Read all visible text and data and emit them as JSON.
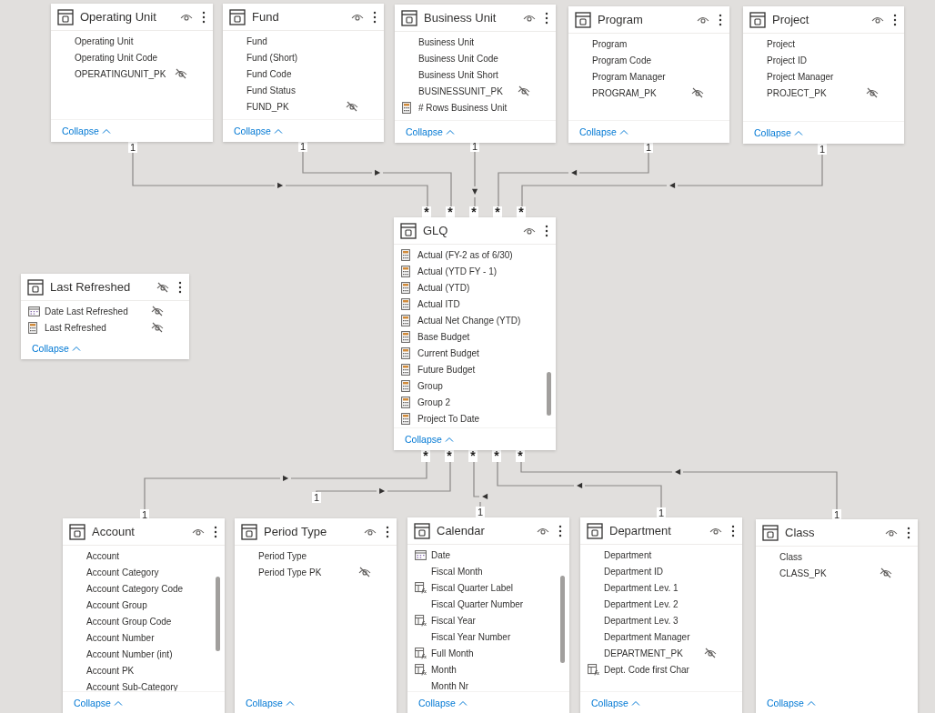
{
  "tables": [
    {
      "name": "Operating Unit",
      "hidden": false,
      "footer": "Collapse",
      "fields": [
        {
          "name": "Operating Unit",
          "kind": "column",
          "hidden": false
        },
        {
          "name": "Operating Unit Code",
          "kind": "column",
          "hidden": false
        },
        {
          "name": "OPERATINGUNIT_PK",
          "kind": "column",
          "hidden": true
        }
      ]
    },
    {
      "name": "Fund",
      "hidden": false,
      "footer": "Collapse",
      "fields": [
        {
          "name": "Fund",
          "kind": "column",
          "hidden": false
        },
        {
          "name": "Fund (Short)",
          "kind": "column",
          "hidden": false
        },
        {
          "name": "Fund Code",
          "kind": "column",
          "hidden": false
        },
        {
          "name": "Fund Status",
          "kind": "column",
          "hidden": false
        },
        {
          "name": "FUND_PK",
          "kind": "column",
          "hidden": true
        }
      ]
    },
    {
      "name": "Business Unit",
      "hidden": false,
      "footer": "Collapse",
      "fields": [
        {
          "name": "Business Unit",
          "kind": "column",
          "hidden": false
        },
        {
          "name": "Business Unit Code",
          "kind": "column",
          "hidden": false
        },
        {
          "name": "Business Unit Short",
          "kind": "column",
          "hidden": false
        },
        {
          "name": "BUSINESSUNIT_PK",
          "kind": "column",
          "hidden": true
        },
        {
          "name": "# Rows Business Unit",
          "kind": "measure",
          "hidden": false
        }
      ]
    },
    {
      "name": "Program",
      "hidden": false,
      "footer": "Collapse",
      "fields": [
        {
          "name": "Program",
          "kind": "column",
          "hidden": false
        },
        {
          "name": "Program Code",
          "kind": "column",
          "hidden": false
        },
        {
          "name": "Program Manager",
          "kind": "column",
          "hidden": false
        },
        {
          "name": "PROGRAM_PK",
          "kind": "column",
          "hidden": true
        }
      ]
    },
    {
      "name": "Project",
      "hidden": false,
      "footer": "Collapse",
      "fields": [
        {
          "name": "Project",
          "kind": "column",
          "hidden": false
        },
        {
          "name": "Project ID",
          "kind": "column",
          "hidden": false
        },
        {
          "name": "Project Manager",
          "kind": "column",
          "hidden": false
        },
        {
          "name": "PROJECT_PK",
          "kind": "column",
          "hidden": true
        }
      ]
    },
    {
      "name": "GLQ",
      "hidden": false,
      "footer": "Collapse",
      "fields": [
        {
          "name": "Actual (FY-2 as of 6/30)",
          "kind": "measure",
          "hidden": false
        },
        {
          "name": "Actual (YTD FY - 1)",
          "kind": "measure",
          "hidden": false
        },
        {
          "name": "Actual (YTD)",
          "kind": "measure",
          "hidden": false
        },
        {
          "name": "Actual ITD",
          "kind": "measure",
          "hidden": false
        },
        {
          "name": "Actual Net Change (YTD)",
          "kind": "measure",
          "hidden": false
        },
        {
          "name": "Base Budget",
          "kind": "measure",
          "hidden": false
        },
        {
          "name": "Current Budget",
          "kind": "measure",
          "hidden": false
        },
        {
          "name": "Future Budget",
          "kind": "measure",
          "hidden": false
        },
        {
          "name": "Group",
          "kind": "measure",
          "hidden": false
        },
        {
          "name": "Group 2",
          "kind": "measure",
          "hidden": false
        },
        {
          "name": "Project To Date",
          "kind": "measure",
          "hidden": false
        }
      ]
    },
    {
      "name": "Last Refreshed",
      "hidden": true,
      "footer": "Collapse",
      "fields": [
        {
          "name": "Date Last Refreshed",
          "kind": "date",
          "hidden": true
        },
        {
          "name": "Last Refreshed",
          "kind": "measure",
          "hidden": true
        }
      ]
    },
    {
      "name": "Account",
      "hidden": false,
      "footer": "Collapse",
      "fields": [
        {
          "name": "Account",
          "kind": "column",
          "hidden": false
        },
        {
          "name": "Account Category",
          "kind": "column",
          "hidden": false
        },
        {
          "name": "Account Category Code",
          "kind": "column",
          "hidden": false
        },
        {
          "name": "Account Group",
          "kind": "column",
          "hidden": false
        },
        {
          "name": "Account Group Code",
          "kind": "column",
          "hidden": false
        },
        {
          "name": "Account Number",
          "kind": "column",
          "hidden": false
        },
        {
          "name": "Account Number (int)",
          "kind": "column",
          "hidden": false
        },
        {
          "name": "Account PK",
          "kind": "column",
          "hidden": false
        },
        {
          "name": "Account Sub-Category",
          "kind": "column",
          "hidden": false
        }
      ]
    },
    {
      "name": "Period Type",
      "hidden": false,
      "footer": "Collapse",
      "fields": [
        {
          "name": "Period Type",
          "kind": "column",
          "hidden": false
        },
        {
          "name": "Period Type PK",
          "kind": "column",
          "hidden": true
        }
      ]
    },
    {
      "name": "Calendar",
      "hidden": false,
      "footer": "Collapse",
      "fields": [
        {
          "name": "Date",
          "kind": "date",
          "hidden": false
        },
        {
          "name": "Fiscal Month",
          "kind": "column",
          "hidden": false
        },
        {
          "name": "Fiscal Quarter Label",
          "kind": "calculated",
          "hidden": false
        },
        {
          "name": "Fiscal Quarter Number",
          "kind": "column",
          "hidden": false
        },
        {
          "name": "Fiscal Year",
          "kind": "calculated",
          "hidden": false
        },
        {
          "name": "Fiscal Year Number",
          "kind": "column",
          "hidden": false
        },
        {
          "name": "Full Month",
          "kind": "calculated",
          "hidden": false
        },
        {
          "name": "Month",
          "kind": "calculated",
          "hidden": false
        },
        {
          "name": "Month Nr",
          "kind": "column",
          "hidden": false
        }
      ]
    },
    {
      "name": "Department",
      "hidden": false,
      "footer": "Collapse",
      "fields": [
        {
          "name": "Department",
          "kind": "column",
          "hidden": false
        },
        {
          "name": "Department ID",
          "kind": "column",
          "hidden": false
        },
        {
          "name": "Department Lev. 1",
          "kind": "column",
          "hidden": false
        },
        {
          "name": "Department Lev. 2",
          "kind": "column",
          "hidden": false
        },
        {
          "name": "Department Lev. 3",
          "kind": "column",
          "hidden": false
        },
        {
          "name": "Department Manager",
          "kind": "column",
          "hidden": false
        },
        {
          "name": "DEPARTMENT_PK",
          "kind": "column",
          "hidden": true
        },
        {
          "name": "Dept. Code first Char",
          "kind": "calculated",
          "hidden": false
        }
      ]
    },
    {
      "name": "Class",
      "hidden": false,
      "footer": "Collapse",
      "fields": [
        {
          "name": "Class",
          "kind": "column",
          "hidden": false
        },
        {
          "name": "CLASS_PK",
          "kind": "column",
          "hidden": true
        }
      ]
    }
  ],
  "relationships": [
    {
      "one": "1",
      "many": "*",
      "arrow": "▶"
    },
    {
      "one": "1",
      "many": "*",
      "arrow": "▶"
    },
    {
      "one": "1",
      "many": "*",
      "arrow": "▼"
    },
    {
      "one": "1",
      "many": "*",
      "arrow": "◀"
    },
    {
      "one": "1",
      "many": "*",
      "arrow": "◀"
    },
    {
      "one": "1",
      "many": "*",
      "arrow": "▶"
    },
    {
      "one": "1",
      "many": "*",
      "arrow": "▶"
    },
    {
      "one": "1",
      "many": "*",
      "arrow": "◀"
    },
    {
      "one": "1",
      "many": "*",
      "arrow": "◀"
    },
    {
      "one": "1",
      "many": "*",
      "arrow": "◀"
    }
  ]
}
